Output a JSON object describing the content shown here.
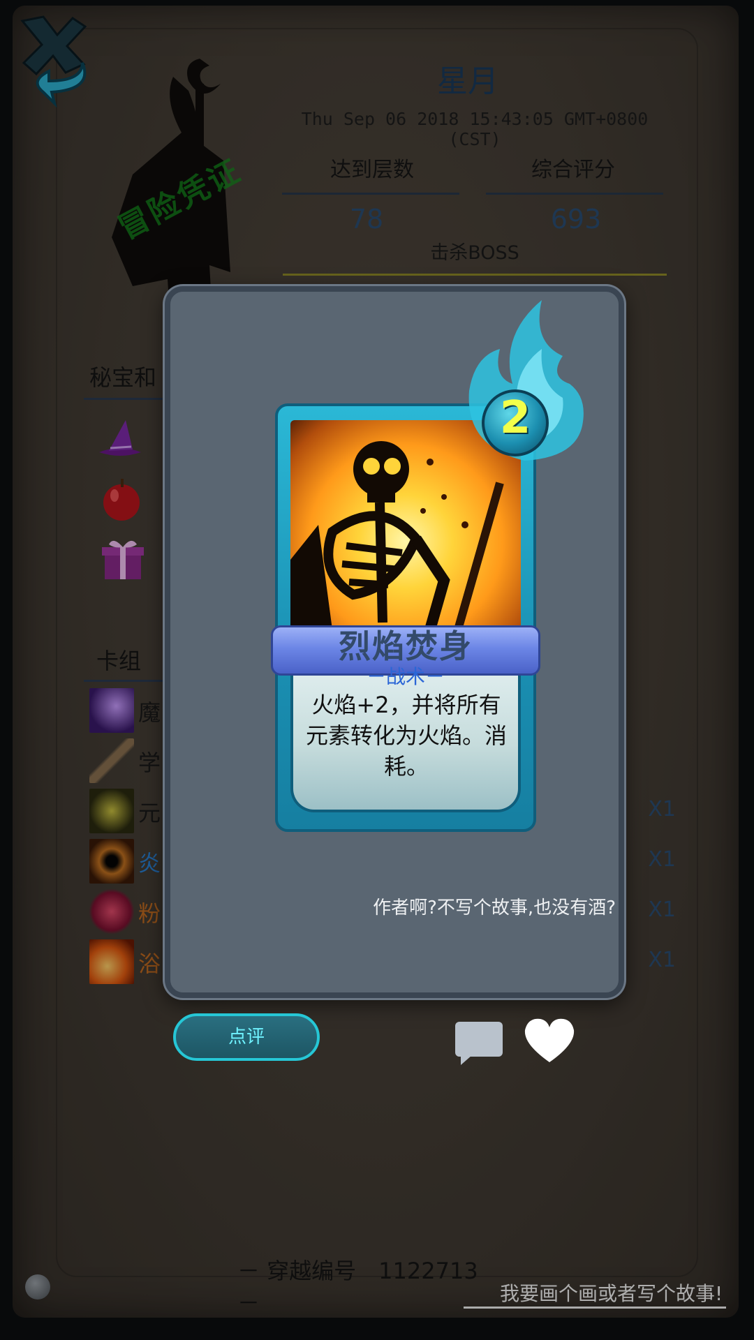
{
  "profile": {
    "stamp_text": "冒险凭证",
    "name": "星月",
    "timestamp": "Thu Sep 06 2018 15:43:05 GMT+0800 (CST)",
    "stats": [
      {
        "label": "达到层数",
        "value": "78"
      },
      {
        "label": "综合评分",
        "value": "693"
      }
    ],
    "boss_label": "击杀BOSS"
  },
  "treasures": {
    "title": "秘宝和",
    "items": [
      "wizard-hat-icon",
      "apple-icon",
      "gift-box-icon"
    ]
  },
  "deck": {
    "title": "卡组",
    "rows": [
      {
        "name": "魔",
        "count": "",
        "color": "#1a1a1a",
        "icon": "magic-missile-icon"
      },
      {
        "name": "学",
        "count": "",
        "color": "#1a1a1a",
        "icon": "staff-icon"
      },
      {
        "name": "元",
        "count": "X1",
        "color": "#1a1a1a",
        "icon": "element-icon"
      },
      {
        "name": "炎",
        "count": "X1",
        "color": "#2a7fd0",
        "icon": "fire-ring-icon"
      },
      {
        "name": "粉",
        "count": "X1",
        "color": "#c06a20",
        "icon": "bow-icon"
      },
      {
        "name": "浴",
        "count": "X1",
        "color": "#c06a20",
        "icon": "fire-bath-icon"
      }
    ]
  },
  "footer": {
    "serial": "－ 穿越编号　1122713 －",
    "story_link": "我要画个画或者写个故事!"
  },
  "card_popup": {
    "cost": "2",
    "title": "烈焰焚身",
    "type": "－战术－",
    "description": "火焰+2，并将所有元素转化为火焰。消耗。",
    "author_note": "作者啊?不写个故事,也没有酒?",
    "review_button": "点评"
  },
  "colors": {
    "accent_cyan": "#26c7d6",
    "parchment": "#433c34",
    "panel": "#5a6672"
  }
}
